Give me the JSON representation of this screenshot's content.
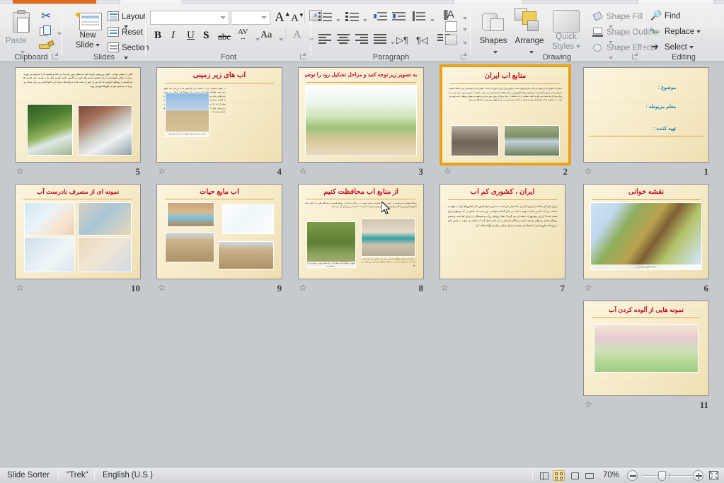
{
  "app": {
    "view_name": "Slide Sorter",
    "theme_name": "\"Trek\"",
    "language": "English (U.S.)",
    "zoom_level": "70%",
    "accent_selected": "#e8a317",
    "ribbon_tab_color": "#e06c18"
  },
  "ribbon": {
    "groups": [
      {
        "name": "Clipboard",
        "label": "Clipboard"
      },
      {
        "name": "Slides",
        "label": "Slides"
      },
      {
        "name": "Font",
        "label": "Font"
      },
      {
        "name": "Paragraph",
        "label": "Paragraph"
      },
      {
        "name": "Drawing",
        "label": "Drawing"
      },
      {
        "name": "Editing",
        "label": "Editing"
      }
    ],
    "clipboard": {
      "paste_label": "Paste",
      "cut_icon": "scissors-icon",
      "copy_icon": "copy-icon",
      "format_painter_icon": "format-painter-icon"
    },
    "slides": {
      "new_slide_label": "New\nSlide",
      "new_slide_line1": "New",
      "new_slide_line2": "Slide",
      "layout_label": "Layout",
      "reset_label": "Reset",
      "section_label": "Section"
    },
    "font": {
      "font_name_value": "",
      "font_size_value": "",
      "grow_font": "A",
      "shrink_font": "A",
      "clear_formatting": "clear-formatting-icon",
      "bold": "B",
      "italic": "I",
      "underline": "U",
      "shadow": "S",
      "strikethrough": "abc",
      "character_spacing": "AV",
      "change_case": "Aa",
      "font_color": "A"
    },
    "paragraph": {
      "bullets": "bullets-icon",
      "numbering": "numbering-icon",
      "decrease_indent": "decrease-indent-icon",
      "increase_indent": "increase-indent-icon",
      "line_spacing": "line-spacing-icon",
      "align_left": "align-left-icon",
      "align_center": "align-center-icon",
      "align_right": "align-right-icon",
      "justify": "justify-icon",
      "ltr": "left-to-right-icon",
      "rtl": "right-to-left-icon",
      "columns": "columns-icon",
      "text_direction": "text-direction-icon",
      "align_text": "align-text-icon",
      "convert_smartart": "convert-to-smartart-icon"
    },
    "drawing": {
      "shapes_label": "Shapes",
      "arrange_label": "Arrange",
      "quick_styles_label_1": "Quick",
      "quick_styles_label_2": "Styles",
      "shape_fill_label": "Shape Fill",
      "shape_outline_label": "Shape Outline",
      "shape_effects_label": "Shape Effects"
    },
    "editing": {
      "find_label": "Find",
      "replace_label": "Replace",
      "select_label": "Select"
    }
  },
  "slides": [
    {
      "number": "5",
      "kind": "text-photos",
      "title": "",
      "body": "گاهی در بعضی نواحی ، آبهای زیرزمینی خودبه خود به سطح زمین راه پیدا می کنند و چشمه ها را به وجود می آورند.\nبرخی از نواحی کوهستانی ایران همچون دامنه های البرز و زاگرس دارای چشمه های پرآب هستند. این چشمه ها سرچشمه ی رودهای فراوانی اند که پس از عبور از دشت ها به دریاچه ها، دریای خزر، خلیج فارس و دریای عمان می ریزند یا در مسیر خود در کویرها فرو می روند.",
      "photos": [
        "waterfall-forest",
        "waterfall-rocks"
      ]
    },
    {
      "number": "4",
      "kind": "title-photo-text",
      "title": "آب های زیر زمینی",
      "body": "در طول سالیان دراز با انجام دادن آزمایش ها و بررسی ها، آبهای زیرزمینی شناخته شده اند.\nمردم برای استفاده از آبهای زیرزمینی چاه هایی حفر می کنند. ایرانیان اولین کسانی بودند که با کندن قنات از آبهای زیرزمینی استفاده کرده اند. امروزه به علت استفاده ی بیش از حد از آب های زیرزمینی و کم شدن بارندگی ها، سطح آب زیرزمینی پایین آمده است و در نتیجه بعضی از چاه ها و قنات ها خشک شده اند.",
      "photos": [
        "water-pump-field"
      ],
      "photo_caption": "تصویر یک چاه عمیق کشاورزی در استان خوزستان"
    },
    {
      "number": "3",
      "kind": "title-bigphoto",
      "title": "به تصویر زیر توجه کنید و مراحل تشکیل رود را توضیح دهید.",
      "body": "",
      "photos": [
        "water-cycle-diagram"
      ]
    },
    {
      "number": "2",
      "kind": "title-text-photos",
      "selected": true,
      "title": "منابع آب ایران",
      "body": "بخش آب کشور که از وجود بارندگی های فراوان است، منابع بزرگی برای تأمین آب است.\nآبهایی که از کوه های سر به فلک کشیده سرازیر شده و برای آشامیدن، شستشو، تولید کشاورزی و سایر فعالیت ها مصرف می شود.\nمنابع آب شیرین زمین، نیاز خود را از برف و باران به دست می آورند.\nالف ـ بخشی از آب حاصل از برف و باران روی زمین جاری و جمع می شود و رودها را به وجود می آورد.\nب ـ بخشی از آب حاصل از برف و باران به داخل زمین فرو می رود و آبهای زیرزمینی را تشکیل می دهد.",
      "photos": [
        "river-muddy",
        "river-valley"
      ]
    },
    {
      "number": "1",
      "kind": "title-slide",
      "title": "",
      "fields": [
        "موضوع :",
        "معلم مربوطه :",
        "تهیه کننده :"
      ]
    },
    {
      "number": "10",
      "kind": "title-photogrid",
      "title": "نمونه ای از مصرف نادرست آب",
      "body": "",
      "photos": [
        "cartoon-shaving",
        "cartoon-washing-yard",
        "cartoon-shower",
        "cartoon-car-wash"
      ]
    },
    {
      "number": "9",
      "kind": "title-photogrid",
      "title": "آب مایع حیات",
      "body": "",
      "photos": [
        "cow-in-water",
        "cartoon-speech",
        "cracked-earth-tap",
        "cracked-earth-field"
      ]
    },
    {
      "number": "8",
      "kind": "title-text-photos",
      "title": "از منابع آب محافظت کنیم",
      "body": "رودها همچنین سرچشمه ی اصلی حیات هستند و نقش مهمی در زندگی ما دارند. رودها همچنین زیستگاه هایی از ماهی ها و جانوران آبزی و پرندگان مهاجرند. آلوده کردن و مصرف ندادن آب، باعث از بین رفتن آن می شود.",
      "photos": [
        "drip-irrigation-corn",
        "dam-reservoir"
      ],
      "captions": [
        "تصویر دستگاه آبیاری قطره ای برای صرفه جویی در مصرف آب در کشاورزی",
        "در یکی از راه های جلوگیری از هدر رفتن آب ساختن سد است که در پشت آن آب جمع می شود و به کمک نیروگاه برق آبی، برق تولید می شود"
      ]
    },
    {
      "number": "7",
      "kind": "title-text",
      "title": "ایران ، کشوری کم آب",
      "body": "میزان بارندگی سالانه در ایران کمتر از ۲۵۰ میلی متر است، به همین دلیل کشور ما از کشورهای کم آب جهان به حساب می آید. آیا می دانید با توجه به آنچه در سال گذشته خواندید، این پدیده چه عاملی در آب و هوای ایران بیشتر است؟ از این موضوع چه نتیجه ای می گیرید؟\nتعداد رودهای پرآب و همیشگی در ایران کم است و بیشتر رودهای فصلی و موقتی هستند؛ یعنی در هنگام تابستان و یا در اصل فصل کم آب خشک می شوند. به همین دلیل از رودها به طور عمدی با استفاده از تصفیه و تصرف و کمی توان از آنها استفاده کرد."
    },
    {
      "number": "6",
      "kind": "title-bigphoto",
      "title": "نقشه خوانی",
      "body": "",
      "photos": [
        "iran-topographic-map"
      ],
      "photo_caption": "نقشه ناهمواری های ایران"
    },
    {
      "number": "11",
      "kind": "title-bigphoto",
      "title": "نمونه هایی از آلوده کردن آب",
      "body": "",
      "photos": [
        "pollution-village-illustration"
      ]
    }
  ],
  "status_bar": {
    "view_buttons": [
      {
        "name": "normal-view",
        "icon": "normal-view-icon",
        "active": false
      },
      {
        "name": "slide-sorter-view",
        "icon": "slide-sorter-icon",
        "active": true
      },
      {
        "name": "reading-view",
        "icon": "reading-view-icon",
        "active": false
      },
      {
        "name": "slide-show-view",
        "icon": "slide-show-icon",
        "active": false
      }
    ],
    "zoom_out": "zoom-out-icon",
    "zoom_in": "zoom-in-icon",
    "fit_to_window": "fit-to-window-icon"
  }
}
